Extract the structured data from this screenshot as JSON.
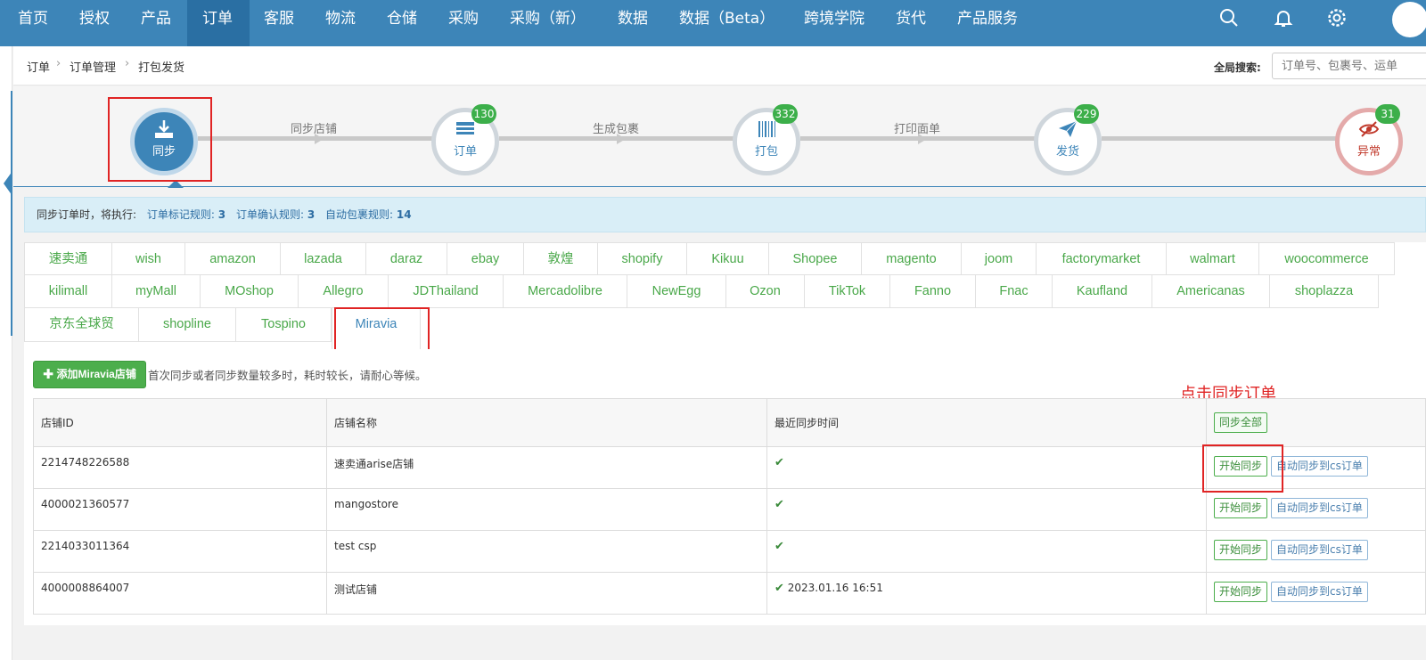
{
  "nav": {
    "items": [
      "首页",
      "授权",
      "产品",
      "订单",
      "客服",
      "物流",
      "仓储",
      "采购",
      "采购（新）",
      "数据",
      "数据（Beta）",
      "跨境学院",
      "货代",
      "产品服务"
    ],
    "active_index": 3,
    "icons": [
      "search-icon",
      "bell-icon",
      "gear-icon"
    ]
  },
  "breadcrumb": [
    "订单",
    "订单管理",
    "打包发货"
  ],
  "global_search": {
    "label": "全局搜索:",
    "placeholder": "订单号、包裹号、运单"
  },
  "steps": {
    "items": [
      {
        "label": "同步",
        "badge": "",
        "icon": "download-icon"
      },
      {
        "label": "订单",
        "badge": "130",
        "icon": "list-icon"
      },
      {
        "label": "打包",
        "badge": "332",
        "icon": "barcode-icon"
      },
      {
        "label": "发货",
        "badge": "229",
        "icon": "send-icon"
      },
      {
        "label": "异常",
        "badge": "31",
        "icon": "eye-off-icon"
      }
    ],
    "connectors": [
      "同步店铺",
      "生成包裹",
      "打印面单"
    ]
  },
  "rules": {
    "prefix": "同步订单时，将执行:",
    "items": [
      {
        "label": "订单标记规则:",
        "value": "3"
      },
      {
        "label": "订单确认规则:",
        "value": "3"
      },
      {
        "label": "自动包裹规则:",
        "value": "14"
      }
    ]
  },
  "platforms": {
    "rows": [
      [
        "速卖通",
        "wish",
        "amazon",
        "lazada",
        "daraz",
        "ebay",
        "敦煌",
        "shopify",
        "Kikuu",
        "Shopee",
        "magento",
        "joom",
        "factorymarket",
        "walmart",
        "woocommerce"
      ],
      [
        "kilimall",
        "myMall",
        "MOshop",
        "Allegro",
        "JDThailand",
        "Mercadolibre",
        "NewEgg",
        "Ozon",
        "TikTok",
        "Fanno",
        "Fnac",
        "Kaufland",
        "Americanas",
        "shoplazza"
      ],
      [
        "京东全球贸",
        "shopline",
        "Tospino",
        "Miravia"
      ]
    ],
    "selected": "Miravia"
  },
  "panel": {
    "add_button": "添加Miravia店铺",
    "note": "首次同步或者同步数量较多时，耗时较长，请耐心等候。",
    "annotation": "点击同步订单",
    "columns": [
      "店铺ID",
      "店铺名称",
      "最近同步时间"
    ],
    "sync_all": "同步全部",
    "sync_button": "开始同步",
    "auto_button": "自动同步到cs订单",
    "rows": [
      {
        "id": "2214748226588",
        "name": "速卖通arise店铺",
        "time": ""
      },
      {
        "id": "4000021360577",
        "name": "mangostore",
        "time": ""
      },
      {
        "id": "2214033011364",
        "name": "test csp",
        "time": ""
      },
      {
        "id": "4000008864007",
        "name": "测试店铺",
        "time": "2023.01.16 16:51"
      }
    ]
  },
  "colors": {
    "nav_bg": "#3d85b8",
    "nav_active": "#2a6fa3",
    "badge": "#3caf4a",
    "highlight": "#e02424",
    "platform_text": "#4aa84a"
  }
}
